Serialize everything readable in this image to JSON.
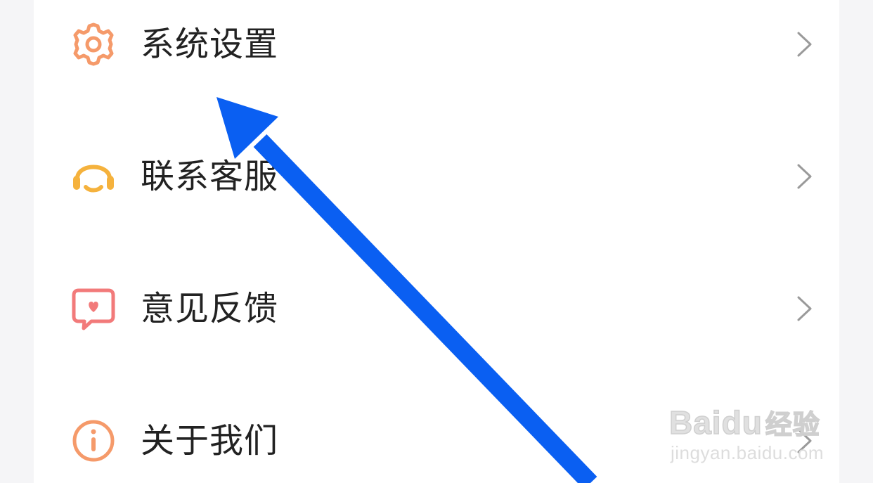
{
  "menu": {
    "items": [
      {
        "label": "系统设置",
        "icon": "gear-icon",
        "color": "#f59a6a"
      },
      {
        "label": "联系客服",
        "icon": "headset-icon",
        "color": "#f5b23d"
      },
      {
        "label": "意见反馈",
        "icon": "chat-heart-icon",
        "color": "#f27a7a"
      },
      {
        "label": "关于我们",
        "icon": "info-icon",
        "color": "#f59a6a"
      }
    ]
  },
  "annotation": {
    "arrow_color": "#0a5ff2"
  },
  "watermark": {
    "brand": "Bai",
    "brand_suffix": "du",
    "brand_cn": "经验",
    "site": "jingyan.baidu.com"
  }
}
